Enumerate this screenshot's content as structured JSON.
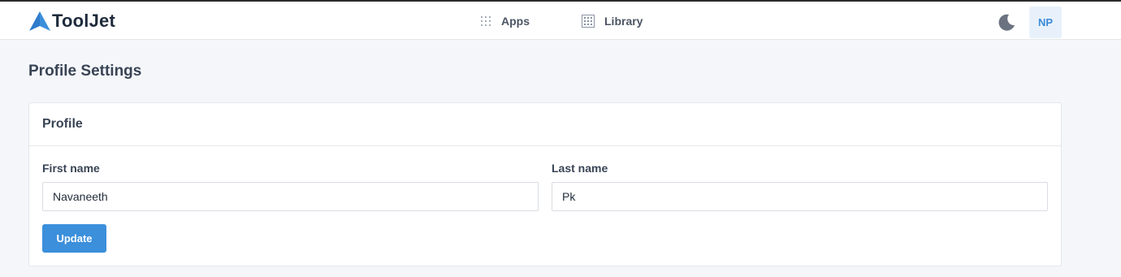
{
  "brand": {
    "name": "ToolJet",
    "logo_icon": "tooljet-logo-icon",
    "accent": "#3b8fdb"
  },
  "nav": {
    "items": [
      {
        "label": "Apps",
        "icon": "apps-grid-icon"
      },
      {
        "label": "Library",
        "icon": "library-icon"
      }
    ],
    "theme_icon": "moon-icon",
    "avatar_initials": "NP"
  },
  "page": {
    "title": "Profile Settings"
  },
  "profile_card": {
    "title": "Profile",
    "first_name": {
      "label": "First name",
      "value": "Navaneeth"
    },
    "last_name": {
      "label": "Last name",
      "value": "Pk"
    },
    "update_label": "Update"
  }
}
